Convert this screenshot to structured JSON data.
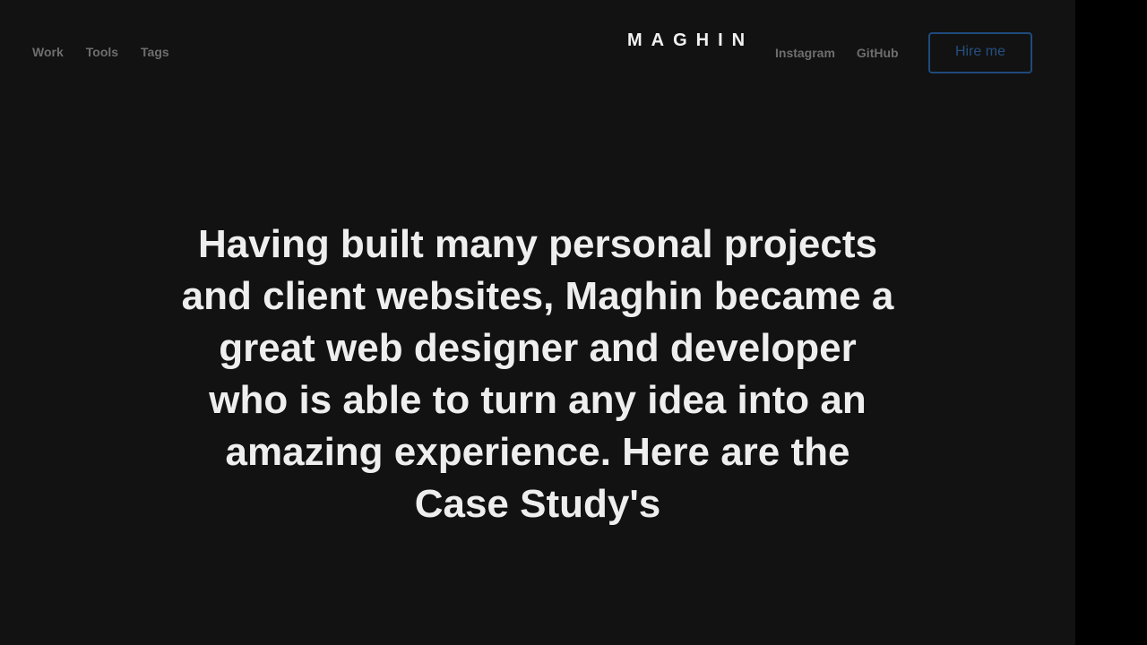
{
  "header": {
    "left_nav": [
      {
        "label": "Work"
      },
      {
        "label": "Tools"
      },
      {
        "label": "Tags"
      }
    ],
    "logo": "MAGHIN",
    "right_nav": [
      {
        "label": "Instagram"
      },
      {
        "label": "GitHub"
      }
    ],
    "cta_label": "Hire me"
  },
  "hero": {
    "text": "Having built many personal projects and client websites, Maghin became a great web designer and developer who is able to turn any idea into an amazing experience. Here are the Case Study's"
  },
  "colors": {
    "background": "#121212",
    "outer_background": "#000000",
    "text_primary": "#eeeeee",
    "nav_text": "#6e6e6e",
    "accent": "#1f4a7c"
  }
}
